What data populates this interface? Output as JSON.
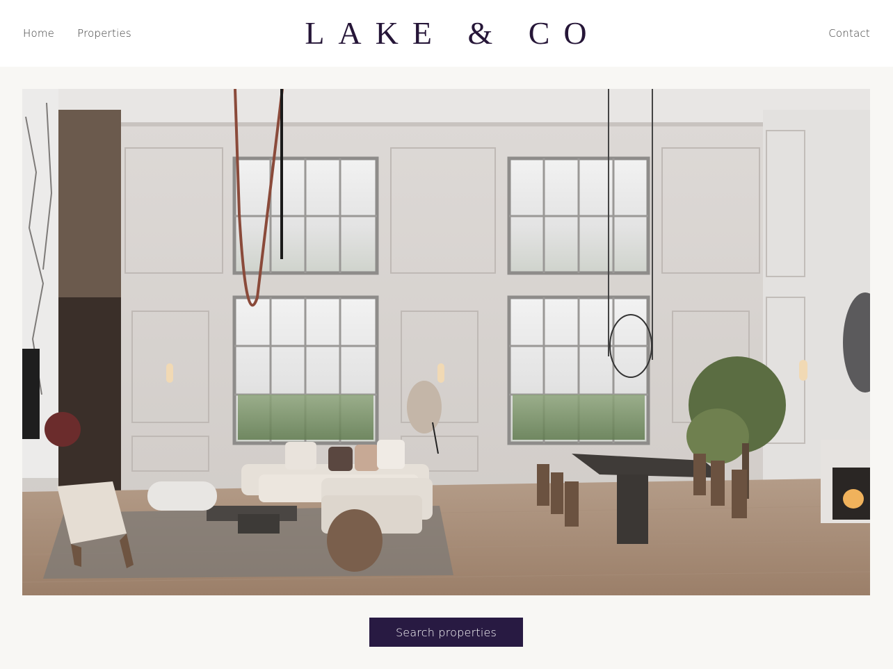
{
  "brand": {
    "logo_text": "LAKE & CO"
  },
  "nav": {
    "left_items": [
      {
        "label": "Home"
      },
      {
        "label": "Properties"
      }
    ],
    "right_items": [
      {
        "label": "Contact"
      }
    ]
  },
  "hero": {
    "image_subject": "luxury-living-room-interior"
  },
  "cta": {
    "label": "Search properties"
  },
  "colors": {
    "accent": "#281a42",
    "logo": "#261638",
    "page_background": "#f8f7f4",
    "header_background": "#ffffff"
  }
}
